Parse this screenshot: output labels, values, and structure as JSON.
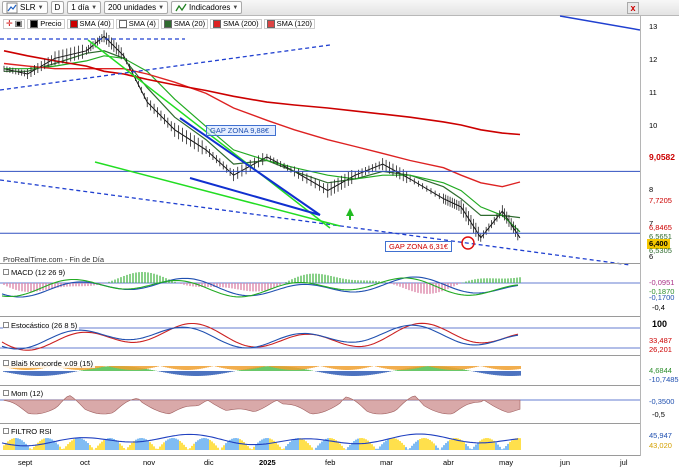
{
  "toolbar": {
    "symbol": "SLR",
    "data_btn": "D",
    "timeframe": "1 día",
    "units": "200 unidades",
    "indicators": "Indicadores",
    "close": "x"
  },
  "legend": {
    "price": "Precio",
    "sma1": "SMA (40)",
    "sma2": "SMA (4)",
    "sma3": "SMA (20)",
    "sma4": "SMA (200)",
    "sma5": "SMA (120)",
    "colors": {
      "price": "#000000",
      "sma40": "#22aa22",
      "sma4": "#ffffff",
      "sma20": "#2f6b2f",
      "sma200": "#cc0000",
      "sma120": "#dd2222"
    }
  },
  "price_axis": {
    "ticks": [
      "13",
      "12",
      "11",
      "10",
      "8",
      "7",
      "6"
    ],
    "tags": {
      "sma200": "9,0582",
      "sma120": "7,7205",
      "sma20": "6,8465",
      "sma40": "6,5305",
      "price": "6,400",
      "band": "6,5651"
    }
  },
  "watermark": "ProRealTime.com - Fin de Día",
  "annotations": {
    "gap_upper": "GAP ZONA 9,88€",
    "gap_lower": "GAP ZONA 6,31€"
  },
  "macd": {
    "title": "MACD (12 26 9)",
    "tags": [
      "-0,0951",
      "-0,1870",
      "-0,1700"
    ],
    "tick": "-0,4"
  },
  "stoch": {
    "title": "Estocástico (26 8 5)",
    "tick_top": "100",
    "tags": [
      "33,487",
      "26,201"
    ]
  },
  "blai5": {
    "title": "Blai5 Koncorde v.09 (15)",
    "tags": [
      "4,6844",
      "-10,7485"
    ]
  },
  "mom": {
    "title": "Mom (12)",
    "tag": "-0,3500",
    "tick": "-0,5"
  },
  "rsi": {
    "title": "FILTRO RSI",
    "tags": [
      "45,947",
      "43,020"
    ]
  },
  "x_axis": [
    "sept",
    "oct",
    "nov",
    "dic",
    "2025",
    "feb",
    "mar",
    "abr",
    "may",
    "jun",
    "jul"
  ],
  "chart_data": {
    "type": "line",
    "title": "",
    "xlabel": "",
    "ylabel": "",
    "ylim": [
      5.7,
      13.3
    ],
    "log_scale": true,
    "x": [
      "2024-08-20",
      "2024-09-01",
      "2024-09-15",
      "2024-10-01",
      "2024-10-10",
      "2024-10-20",
      "2024-11-01",
      "2024-11-15",
      "2024-12-01",
      "2024-12-15",
      "2025-01-01",
      "2025-01-15",
      "2025-02-01",
      "2025-02-15",
      "2025-03-01",
      "2025-03-15",
      "2025-04-01",
      "2025-04-10",
      "2025-04-20",
      "2025-05-01",
      "2025-05-10"
    ],
    "series": [
      {
        "name": "Precio",
        "values": [
          11.3,
          11.1,
          11.7,
          12.0,
          12.6,
          11.8,
          10.1,
          9.2,
          8.6,
          7.9,
          8.4,
          8.0,
          7.5,
          7.9,
          8.2,
          7.8,
          7.3,
          7.1,
          6.4,
          7.0,
          6.4
        ]
      },
      {
        "name": "SMA (20)",
        "values": [
          11.2,
          11.2,
          11.5,
          11.9,
          12.0,
          11.7,
          10.6,
          9.6,
          8.9,
          8.2,
          8.3,
          8.0,
          7.7,
          7.8,
          8.0,
          7.9,
          7.6,
          7.3,
          6.9,
          6.9,
          6.85
        ]
      },
      {
        "name": "SMA (40)",
        "values": [
          11.3,
          11.3,
          11.4,
          11.6,
          11.8,
          11.7,
          11.2,
          10.2,
          9.3,
          8.6,
          8.3,
          8.1,
          7.9,
          7.8,
          7.9,
          7.9,
          7.7,
          7.5,
          7.1,
          6.9,
          6.53
        ]
      },
      {
        "name": "SMA (120)",
        "values": [
          11.5,
          11.4,
          11.3,
          11.3,
          11.3,
          11.3,
          11.1,
          10.8,
          10.4,
          9.9,
          9.5,
          9.2,
          8.9,
          8.7,
          8.5,
          8.3,
          8.1,
          7.9,
          7.7,
          7.6,
          7.72
        ]
      },
      {
        "name": "SMA (200)",
        "values": [
          12.0,
          11.8,
          11.6,
          11.4,
          11.2,
          11.1,
          10.9,
          10.7,
          10.5,
          10.3,
          10.1,
          10.0,
          9.9,
          9.8,
          9.7,
          9.6,
          9.45,
          9.35,
          9.2,
          9.1,
          9.058
        ]
      }
    ],
    "trend_lines": [
      "blue dashed upper channel",
      "blue dashed lower channel",
      "green lines",
      "blue solid wedge",
      "horizontal blue at 8",
      "horizontal blue at 6.5"
    ]
  }
}
